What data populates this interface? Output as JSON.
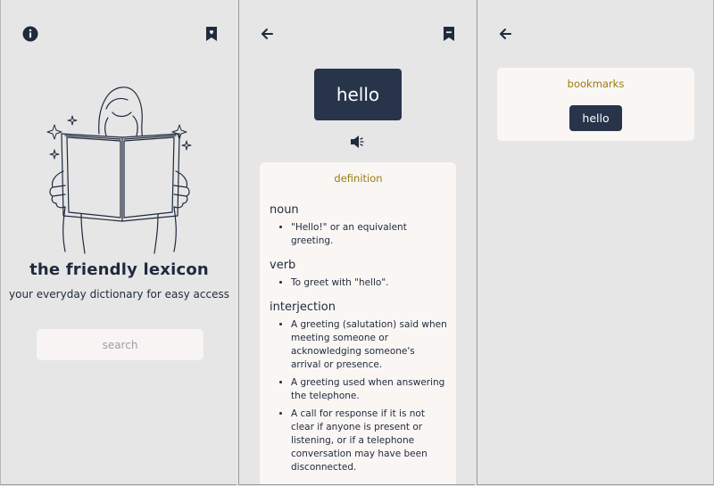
{
  "home": {
    "icons": {
      "info": "info-icon",
      "bookmark": "bookmark-heart-icon"
    },
    "title": "the friendly lexicon",
    "subtitle": "your everyday dictionary for easy access",
    "search_placeholder": "search"
  },
  "definition": {
    "icons": {
      "back": "arrow-left-icon",
      "bookmark": "bookmark-minus-icon",
      "speaker": "speaker-icon"
    },
    "word": "hello",
    "section_title": "definition",
    "meanings": [
      {
        "pos": "noun",
        "defs": [
          "\"Hello!\" or an equivalent greeting."
        ]
      },
      {
        "pos": "verb",
        "defs": [
          "To greet with \"hello\"."
        ]
      },
      {
        "pos": "interjection",
        "defs": [
          "A greeting (salutation) said when meeting someone or acknowledging someone's arrival or presence.",
          "A greeting used when answering the telephone.",
          "A call for response if it is not clear if anyone is present or listening, or if a telephone conversation may have been disconnected."
        ]
      }
    ]
  },
  "bookmarks": {
    "icons": {
      "back": "arrow-left-icon"
    },
    "title": "bookmarks",
    "items": [
      "hello"
    ]
  },
  "colors": {
    "background": "#e6e6e6",
    "navy": "#27344a",
    "accent_gold": "#9c7c12",
    "card": "#f9f6f4"
  }
}
